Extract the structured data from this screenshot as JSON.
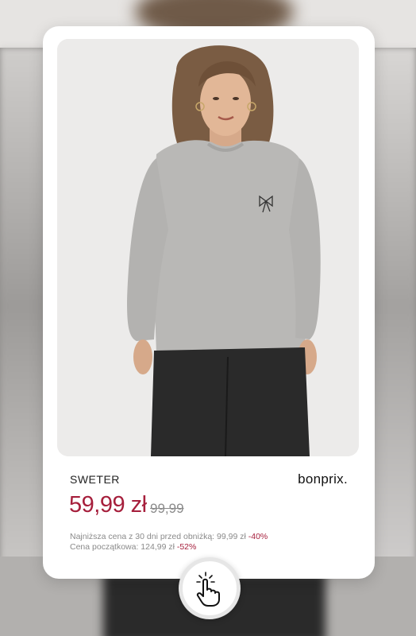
{
  "product": {
    "title": "SWETER",
    "brand": "bonprix.",
    "price": "59,99 zł",
    "old_price": "99,99",
    "lowest_price_label": "Najniższa cena z 30 dni  przed obniżką: 99,99 zł",
    "lowest_price_discount": "-40%",
    "initial_price_label": "Cena początkowa: 124,99 zł",
    "initial_price_discount": "-52%"
  },
  "colors": {
    "accent": "#a61f3c",
    "muted": "#8a8a8a"
  },
  "icons": {
    "tap": "tap-hand-icon"
  }
}
